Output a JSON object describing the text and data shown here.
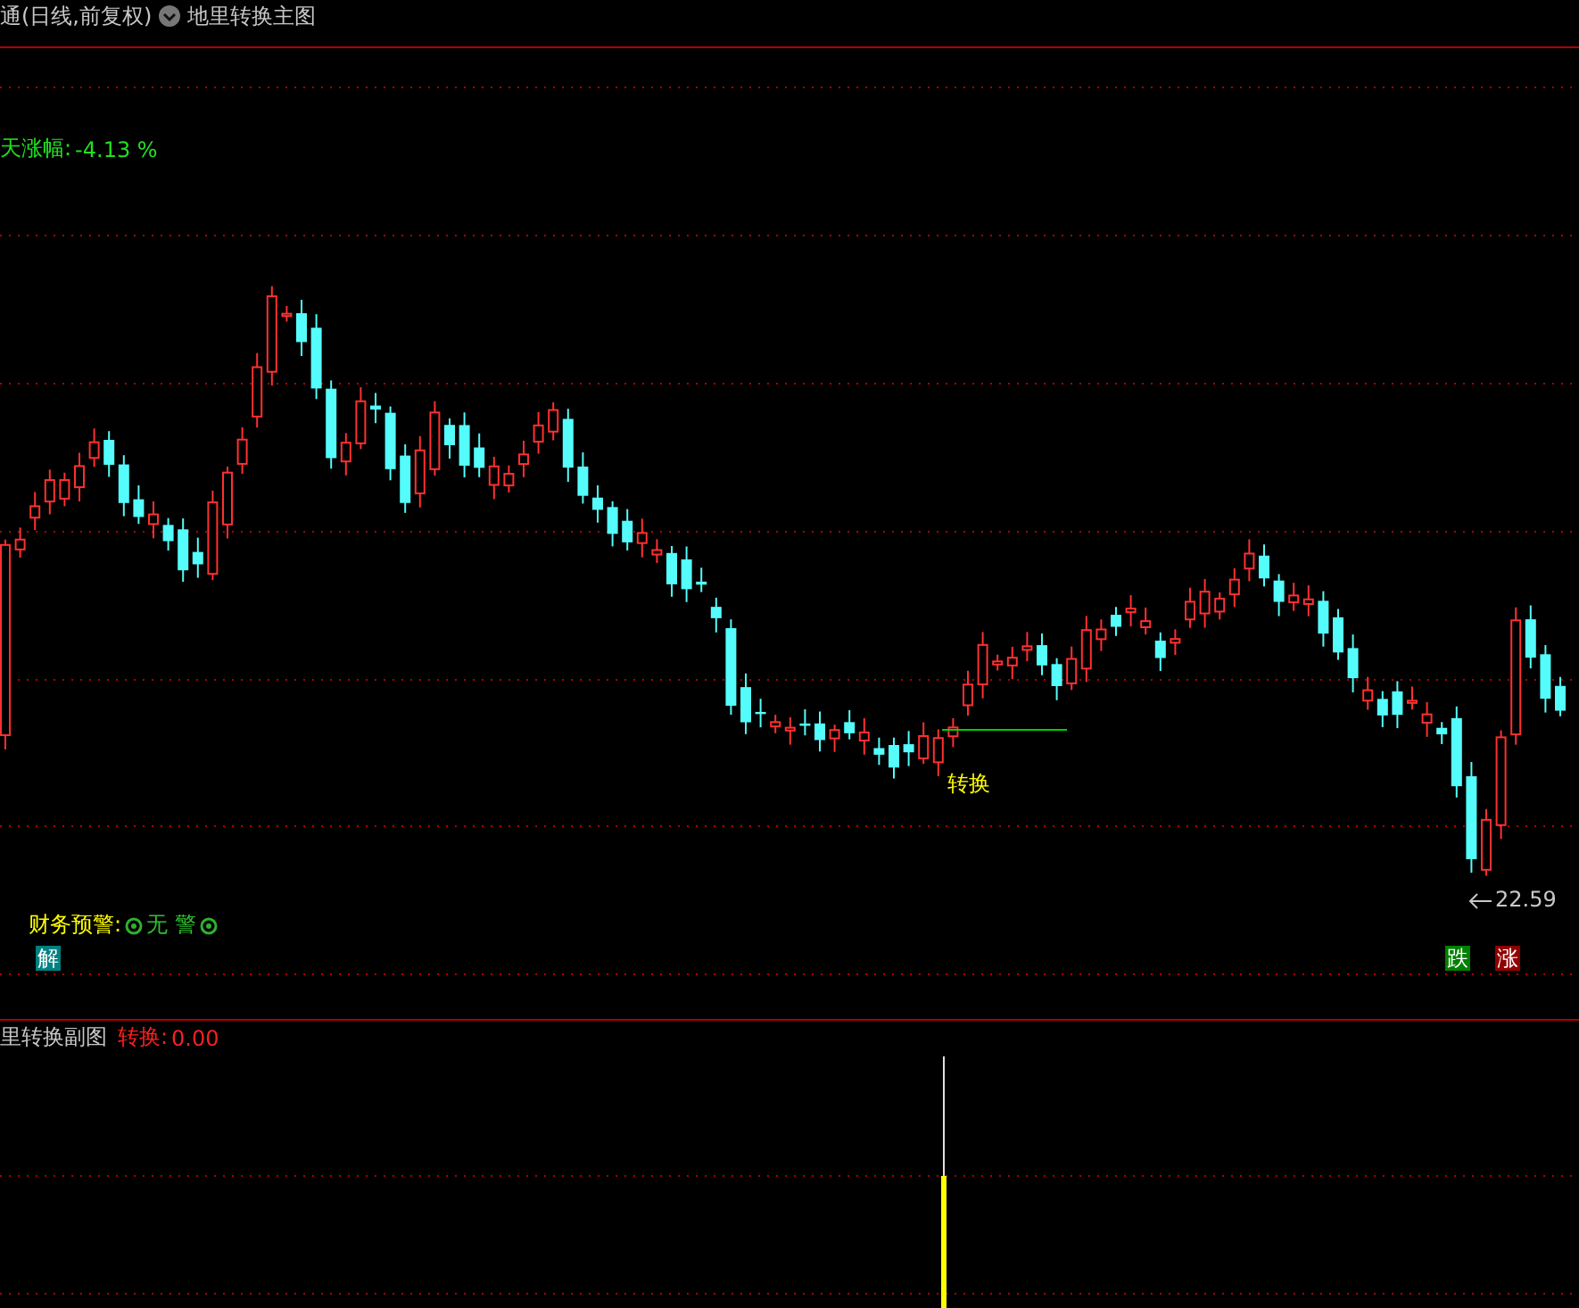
{
  "main_chart": {
    "title": "通(日线,前复权)",
    "indicator_name": "地里转换主图",
    "change_label": "天涨幅:",
    "change_value": "-4.13 %",
    "signal_label": "转换",
    "low_price": "22.59",
    "warning_label": "财务预警:",
    "warning_value": "无 警",
    "markers": [
      {
        "text": "解",
        "kind": "unlock"
      },
      {
        "text": "跌",
        "kind": "down"
      },
      {
        "text": "涨",
        "kind": "up"
      }
    ]
  },
  "sub_chart": {
    "title": "里转换副图",
    "value_label": "转换:",
    "value": "0.00"
  }
}
